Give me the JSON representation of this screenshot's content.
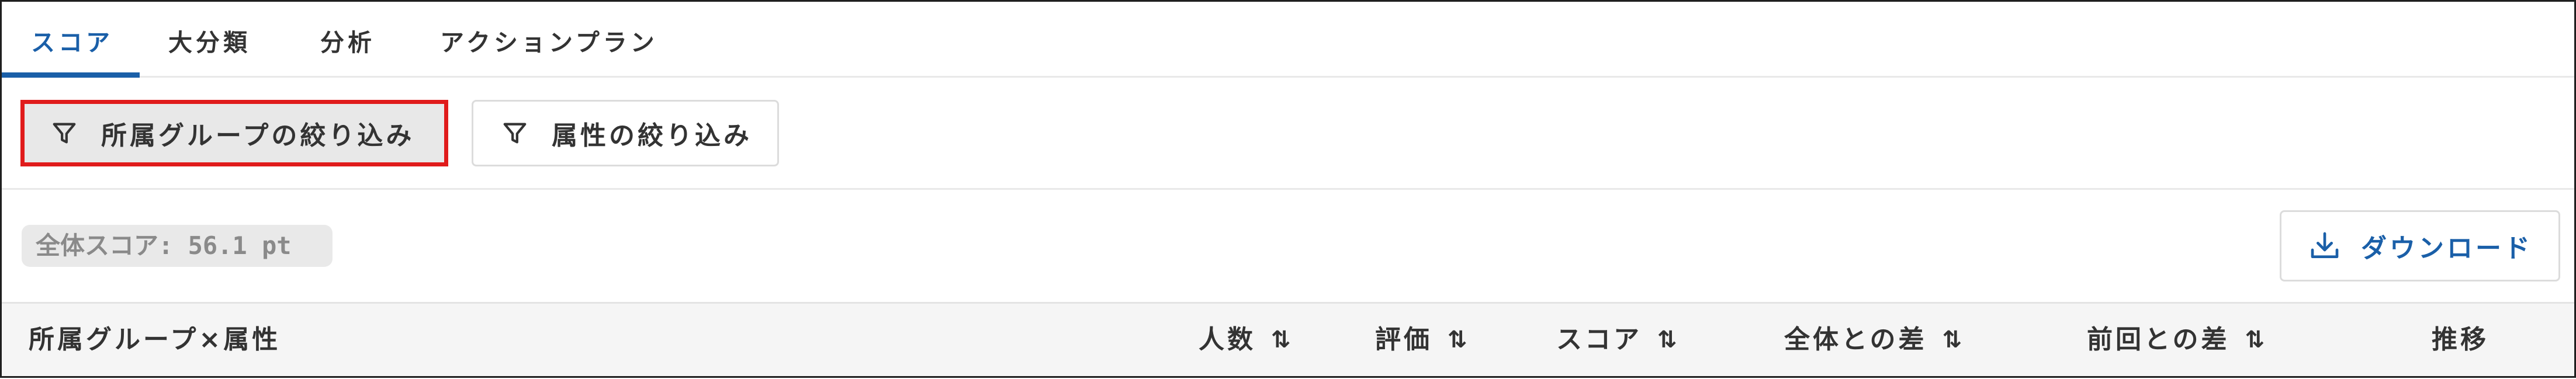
{
  "tabs": [
    {
      "label": "スコア",
      "active": true
    },
    {
      "label": "大分類",
      "active": false
    },
    {
      "label": "分析",
      "active": false
    },
    {
      "label": "アクションプラン",
      "active": false
    }
  ],
  "filters": {
    "group_label": "所属グループの絞り込み",
    "attribute_label": "属性の絞り込み",
    "icon": "filter-icon"
  },
  "score": {
    "label": "全体スコア: 56.1 pt"
  },
  "download": {
    "label": "ダウンロード",
    "icon": "download-icon"
  },
  "table": {
    "columns": [
      {
        "label": "所属グループ×属性",
        "sortable": false
      },
      {
        "label": "人数",
        "sortable": true
      },
      {
        "label": "評価",
        "sortable": true
      },
      {
        "label": "スコア",
        "sortable": true
      },
      {
        "label": "全体との差",
        "sortable": true
      },
      {
        "label": "前回との差",
        "sortable": true
      },
      {
        "label": "推移",
        "sortable": false
      }
    ],
    "sort_icon": "⇅"
  },
  "colors": {
    "accent": "#1a5fa8",
    "highlight_border": "#e01b1b",
    "text": "#333333",
    "muted": "#8a8a8a"
  }
}
